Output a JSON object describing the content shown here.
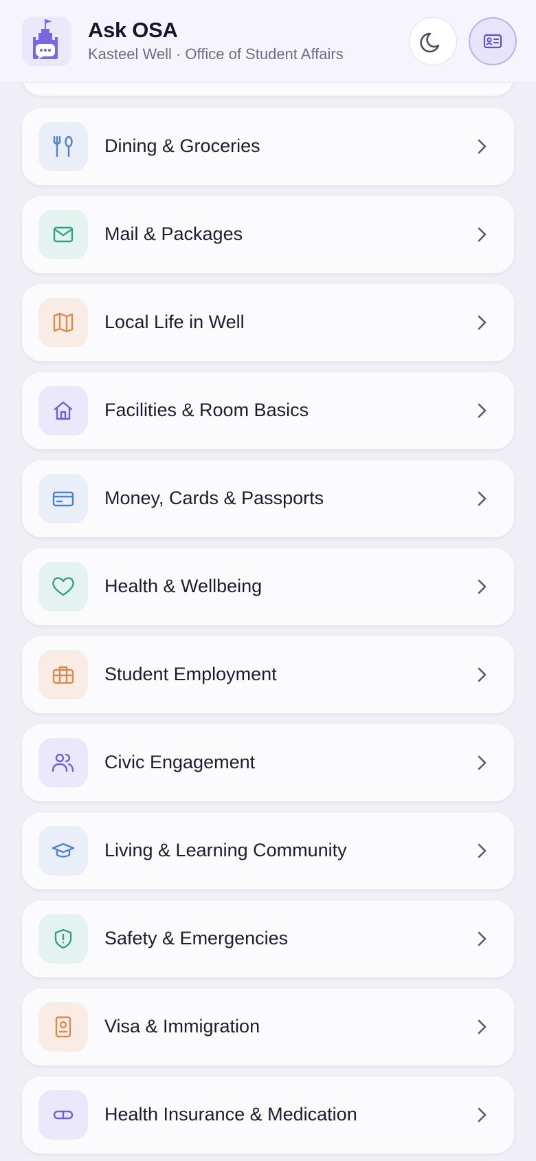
{
  "header": {
    "title": "Ask OSA",
    "subtitle": "Kasteel Well · Office of Student Affairs"
  },
  "categories": [
    {
      "label": "Dining & Groceries",
      "icon": "fork-spoon-icon",
      "tone": "blue"
    },
    {
      "label": "Mail & Packages",
      "icon": "mail-icon",
      "tone": "green"
    },
    {
      "label": "Local Life in Well",
      "icon": "map-icon",
      "tone": "orange"
    },
    {
      "label": "Facilities & Room Basics",
      "icon": "home-icon",
      "tone": "purple"
    },
    {
      "label": "Money, Cards & Passports",
      "icon": "credit-card-icon",
      "tone": "blue"
    },
    {
      "label": "Health & Wellbeing",
      "icon": "heart-icon",
      "tone": "green"
    },
    {
      "label": "Student Employment",
      "icon": "briefcase-icon",
      "tone": "orange"
    },
    {
      "label": "Civic Engagement",
      "icon": "users-icon",
      "tone": "purple"
    },
    {
      "label": "Living & Learning Community",
      "icon": "graduation-cap-icon",
      "tone": "blue"
    },
    {
      "label": "Safety & Emergencies",
      "icon": "shield-alert-icon",
      "tone": "green"
    },
    {
      "label": "Visa & Immigration",
      "icon": "passport-icon",
      "tone": "orange"
    },
    {
      "label": "Health Insurance & Medication",
      "icon": "pill-icon",
      "tone": "purple"
    }
  ],
  "colors": {
    "background": "#efeff5",
    "card": "#fbfbfd",
    "accent": "#7b68e0",
    "tones": {
      "blue": {
        "bg": "#e9eef9",
        "fg": "#4f82c6"
      },
      "green": {
        "bg": "#e4f3ef",
        "fg": "#2fa283"
      },
      "orange": {
        "bg": "#f8ece4",
        "fg": "#d98a4c"
      },
      "purple": {
        "bg": "#ebe8fb",
        "fg": "#6e5fd4"
      }
    }
  }
}
